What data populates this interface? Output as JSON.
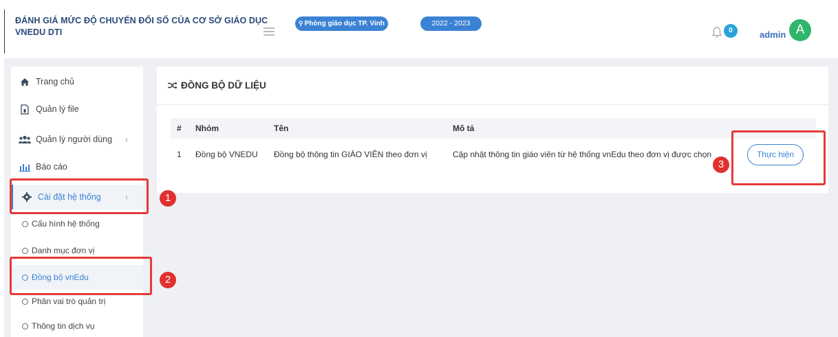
{
  "header": {
    "title_line1": "ĐÁNH GIÁ MỨC ĐỘ CHUYỂN ĐỔI SỐ CỦA CƠ SỞ GIÁO DỤC",
    "title_line2": "VNEDU DTI",
    "unit_label": "Phòng giáo dục TP. Vinh",
    "year_label": "2022 - 2023",
    "notification_count": "0",
    "user_name": "admin",
    "avatar_letter": "A"
  },
  "sidebar": {
    "items": [
      {
        "label": "Trang chủ",
        "icon": "home-icon"
      },
      {
        "label": "Quản lý file",
        "icon": "file-icon"
      },
      {
        "label": "Quản lý người dùng",
        "icon": "users-icon"
      },
      {
        "label": "Báo cáo",
        "icon": "bar-chart-icon"
      },
      {
        "label": "Cài đặt hệ thống",
        "icon": "gear-icon"
      }
    ],
    "sub_items": [
      {
        "label": "Cấu hình hệ thống"
      },
      {
        "label": "Danh mục đơn vị"
      },
      {
        "label": "Đồng bộ vnEdu"
      },
      {
        "label": "Phân vai trò quản trị"
      },
      {
        "label": "Thông tin dịch vụ"
      }
    ]
  },
  "main": {
    "card_title": "ĐỒNG BỘ DỮ LIỆU",
    "table": {
      "headers": [
        "#",
        "Nhóm",
        "Tên",
        "Mô tả"
      ],
      "rows": [
        {
          "index": "1",
          "group": "Đồng bộ VNEDU",
          "name": "Đồng bộ thông tin GIÁO VIÊN theo đơn vị",
          "description": "Cập nhật thông tin giáo viên từ hệ thống vnEdu theo đơn vị được chọn",
          "action_label": "Thực hiện"
        }
      ]
    }
  },
  "annotations": [
    "1",
    "2",
    "3"
  ],
  "colors": {
    "accent": "#3b82d4",
    "title": "#2a4a78",
    "annotation": "#e53939",
    "avatar": "#2fb56c",
    "badge": "#2aa3dc"
  }
}
